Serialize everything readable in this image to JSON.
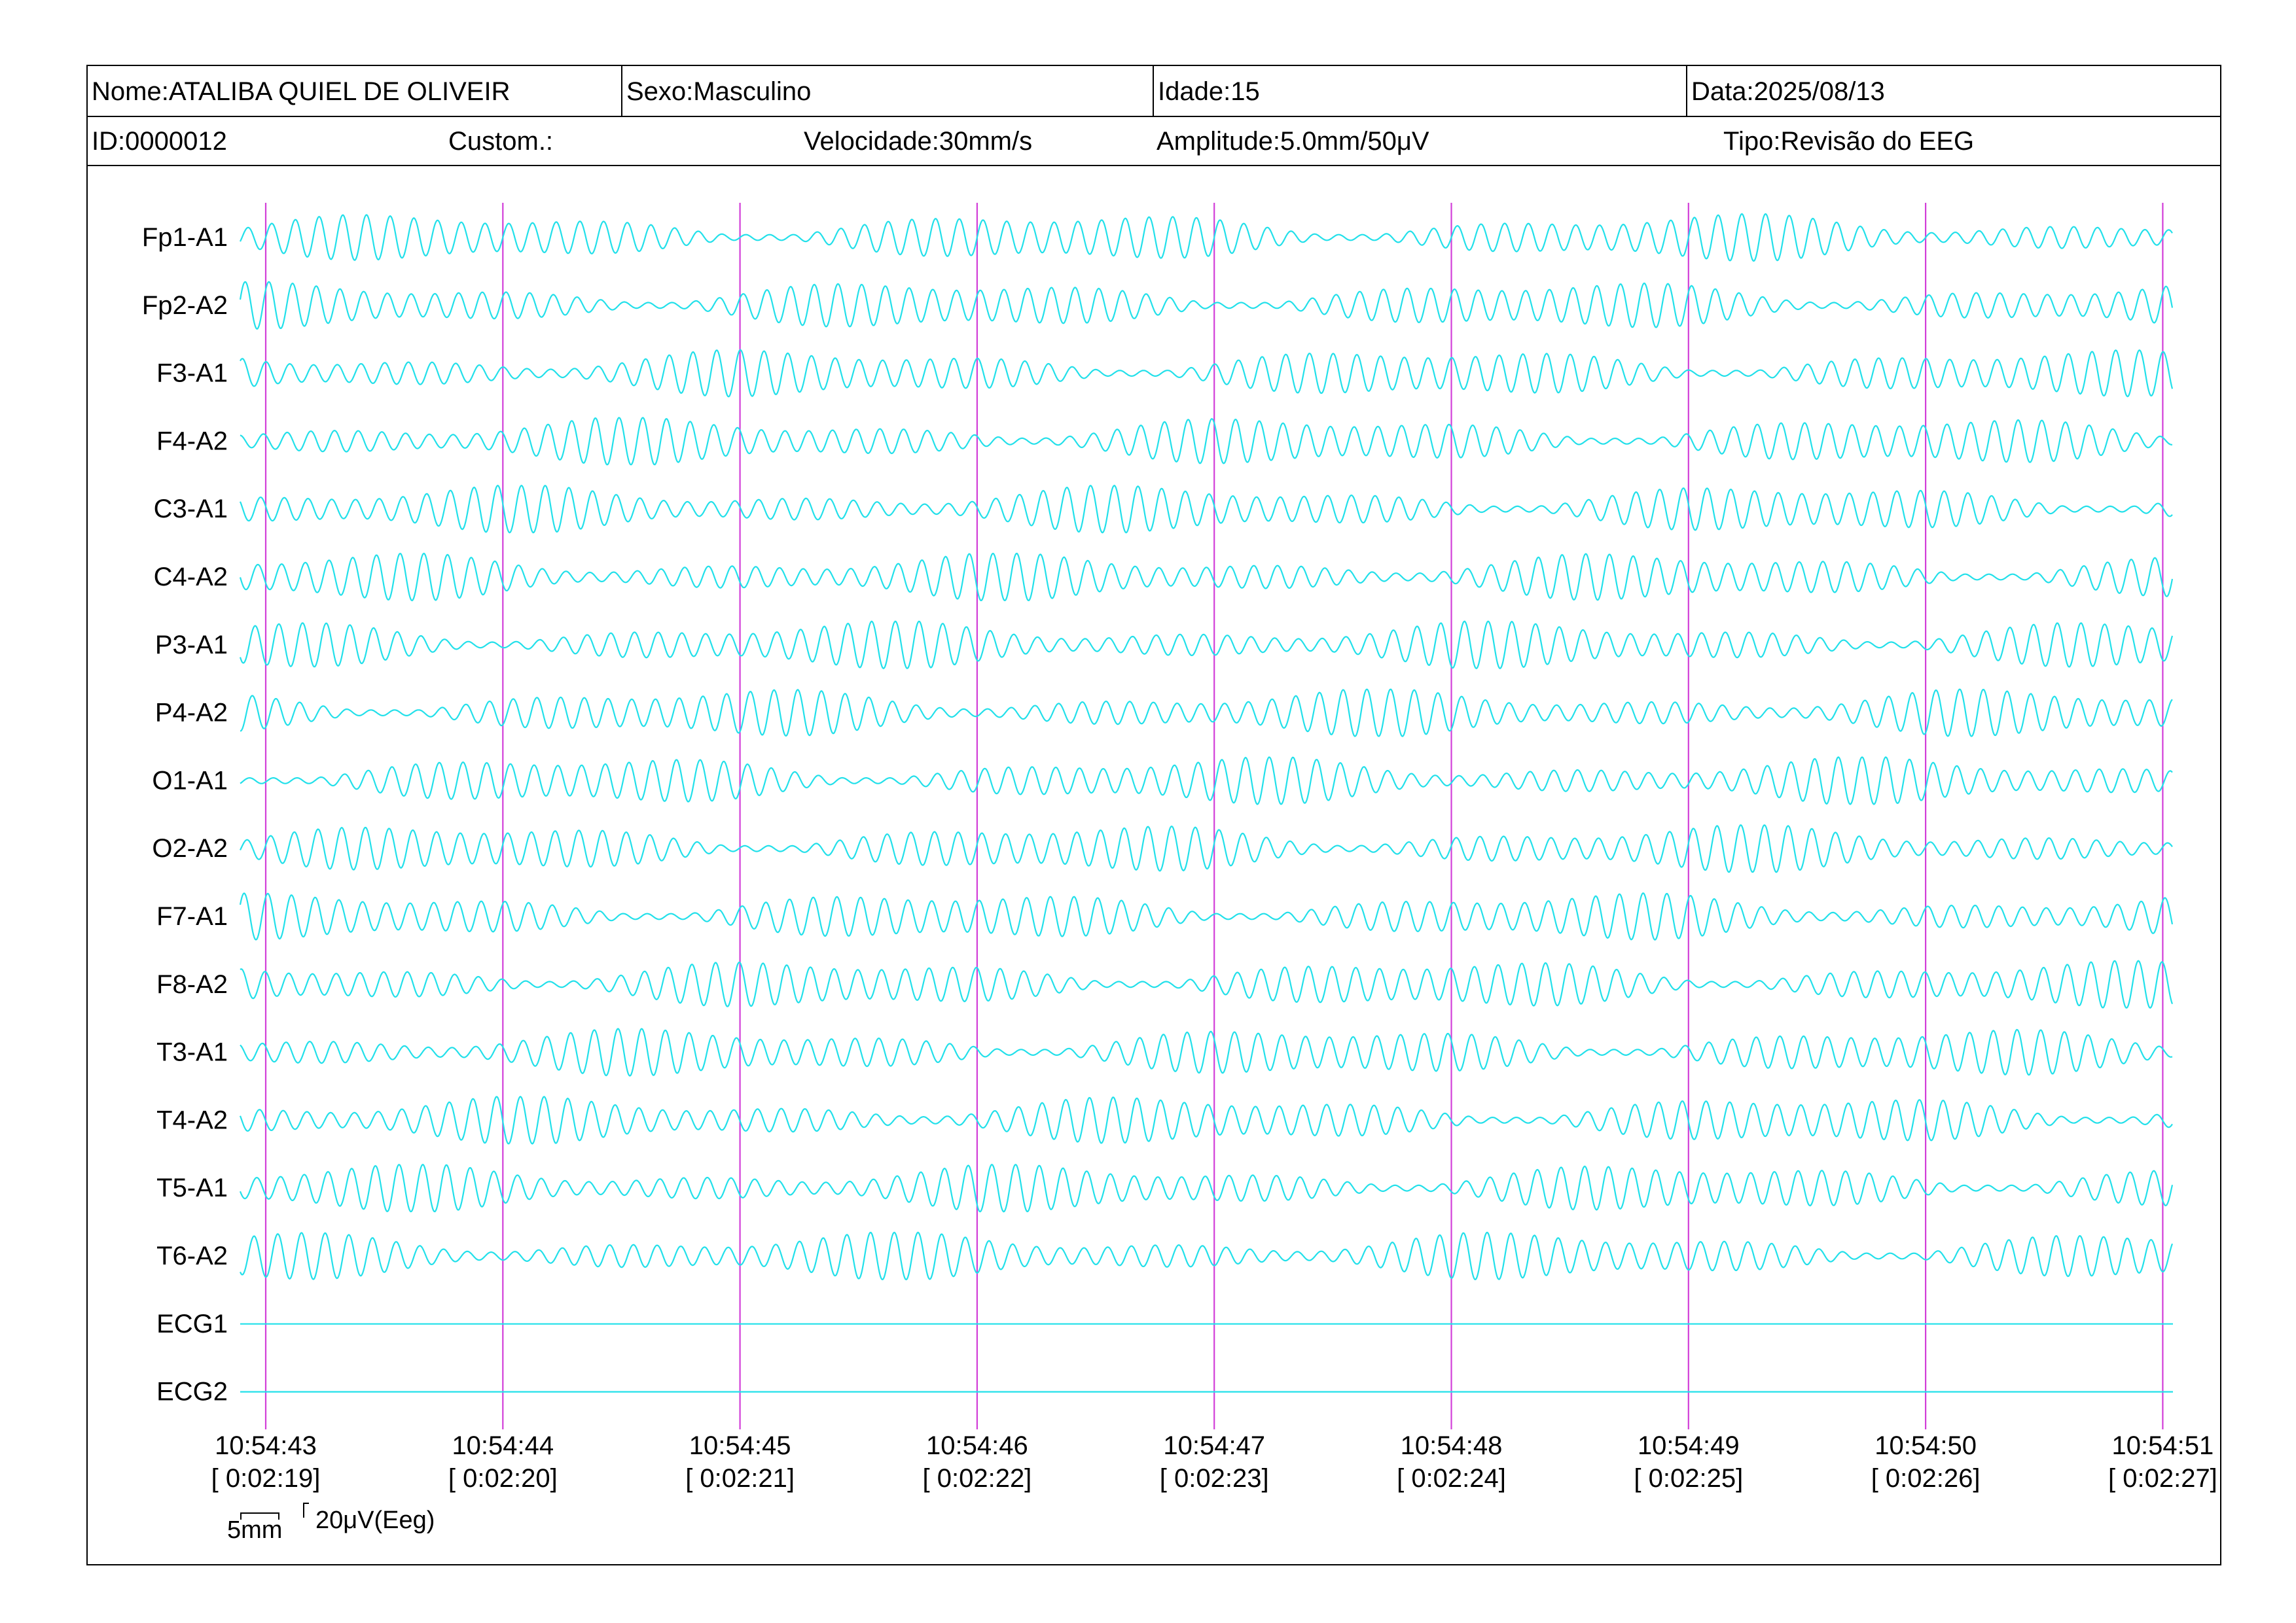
{
  "header": {
    "nome": "Nome:ATALIBA QUIEL DE OLIVEIR",
    "sexo": "Sexo:Masculino",
    "idade": "Idade:15",
    "data": "Data:2025/08/13",
    "id": "ID:0000012",
    "custom": "Custom.:",
    "velocidade": "Velocidade:30mm/s",
    "amplitude": "Amplitude:5.0mm/50μV",
    "tipo": "Tipo:Revisão do EEG"
  },
  "colors": {
    "trace": "#22e0ea",
    "marker": "#d23fd8",
    "text": "#000000",
    "background": "#ffffff"
  },
  "scale_bar": {
    "time_label": "5mm",
    "amp_label": "20μV(Eeg)"
  },
  "chart_data": {
    "type": "line",
    "title": "",
    "channels": [
      "Fp1-A1",
      "Fp2-A2",
      "F3-A1",
      "F4-A2",
      "C3-A1",
      "C4-A2",
      "P3-A1",
      "P4-A2",
      "O1-A1",
      "O2-A2",
      "F7-A1",
      "F8-A2",
      "T3-A1",
      "T4-A2",
      "T5-A1",
      "T6-A2",
      "ECG1",
      "ECG2"
    ],
    "flat_channels": [
      "ECG1",
      "ECG2"
    ],
    "time_ticks": [
      {
        "clock": "10:54:43",
        "elapsed": "[ 0:02:19]"
      },
      {
        "clock": "10:54:44",
        "elapsed": "[ 0:02:20]"
      },
      {
        "clock": "10:54:45",
        "elapsed": "[ 0:02:21]"
      },
      {
        "clock": "10:54:46",
        "elapsed": "[ 0:02:22]"
      },
      {
        "clock": "10:54:47",
        "elapsed": "[ 0:02:23]"
      },
      {
        "clock": "10:54:48",
        "elapsed": "[ 0:02:24]"
      },
      {
        "clock": "10:54:49",
        "elapsed": "[ 0:02:25]"
      },
      {
        "clock": "10:54:50",
        "elapsed": "[ 0:02:26]"
      },
      {
        "clock": "10:54:51",
        "elapsed": "[ 0:02:27]"
      }
    ],
    "dominant_frequency_hz": 10,
    "grid": false
  }
}
